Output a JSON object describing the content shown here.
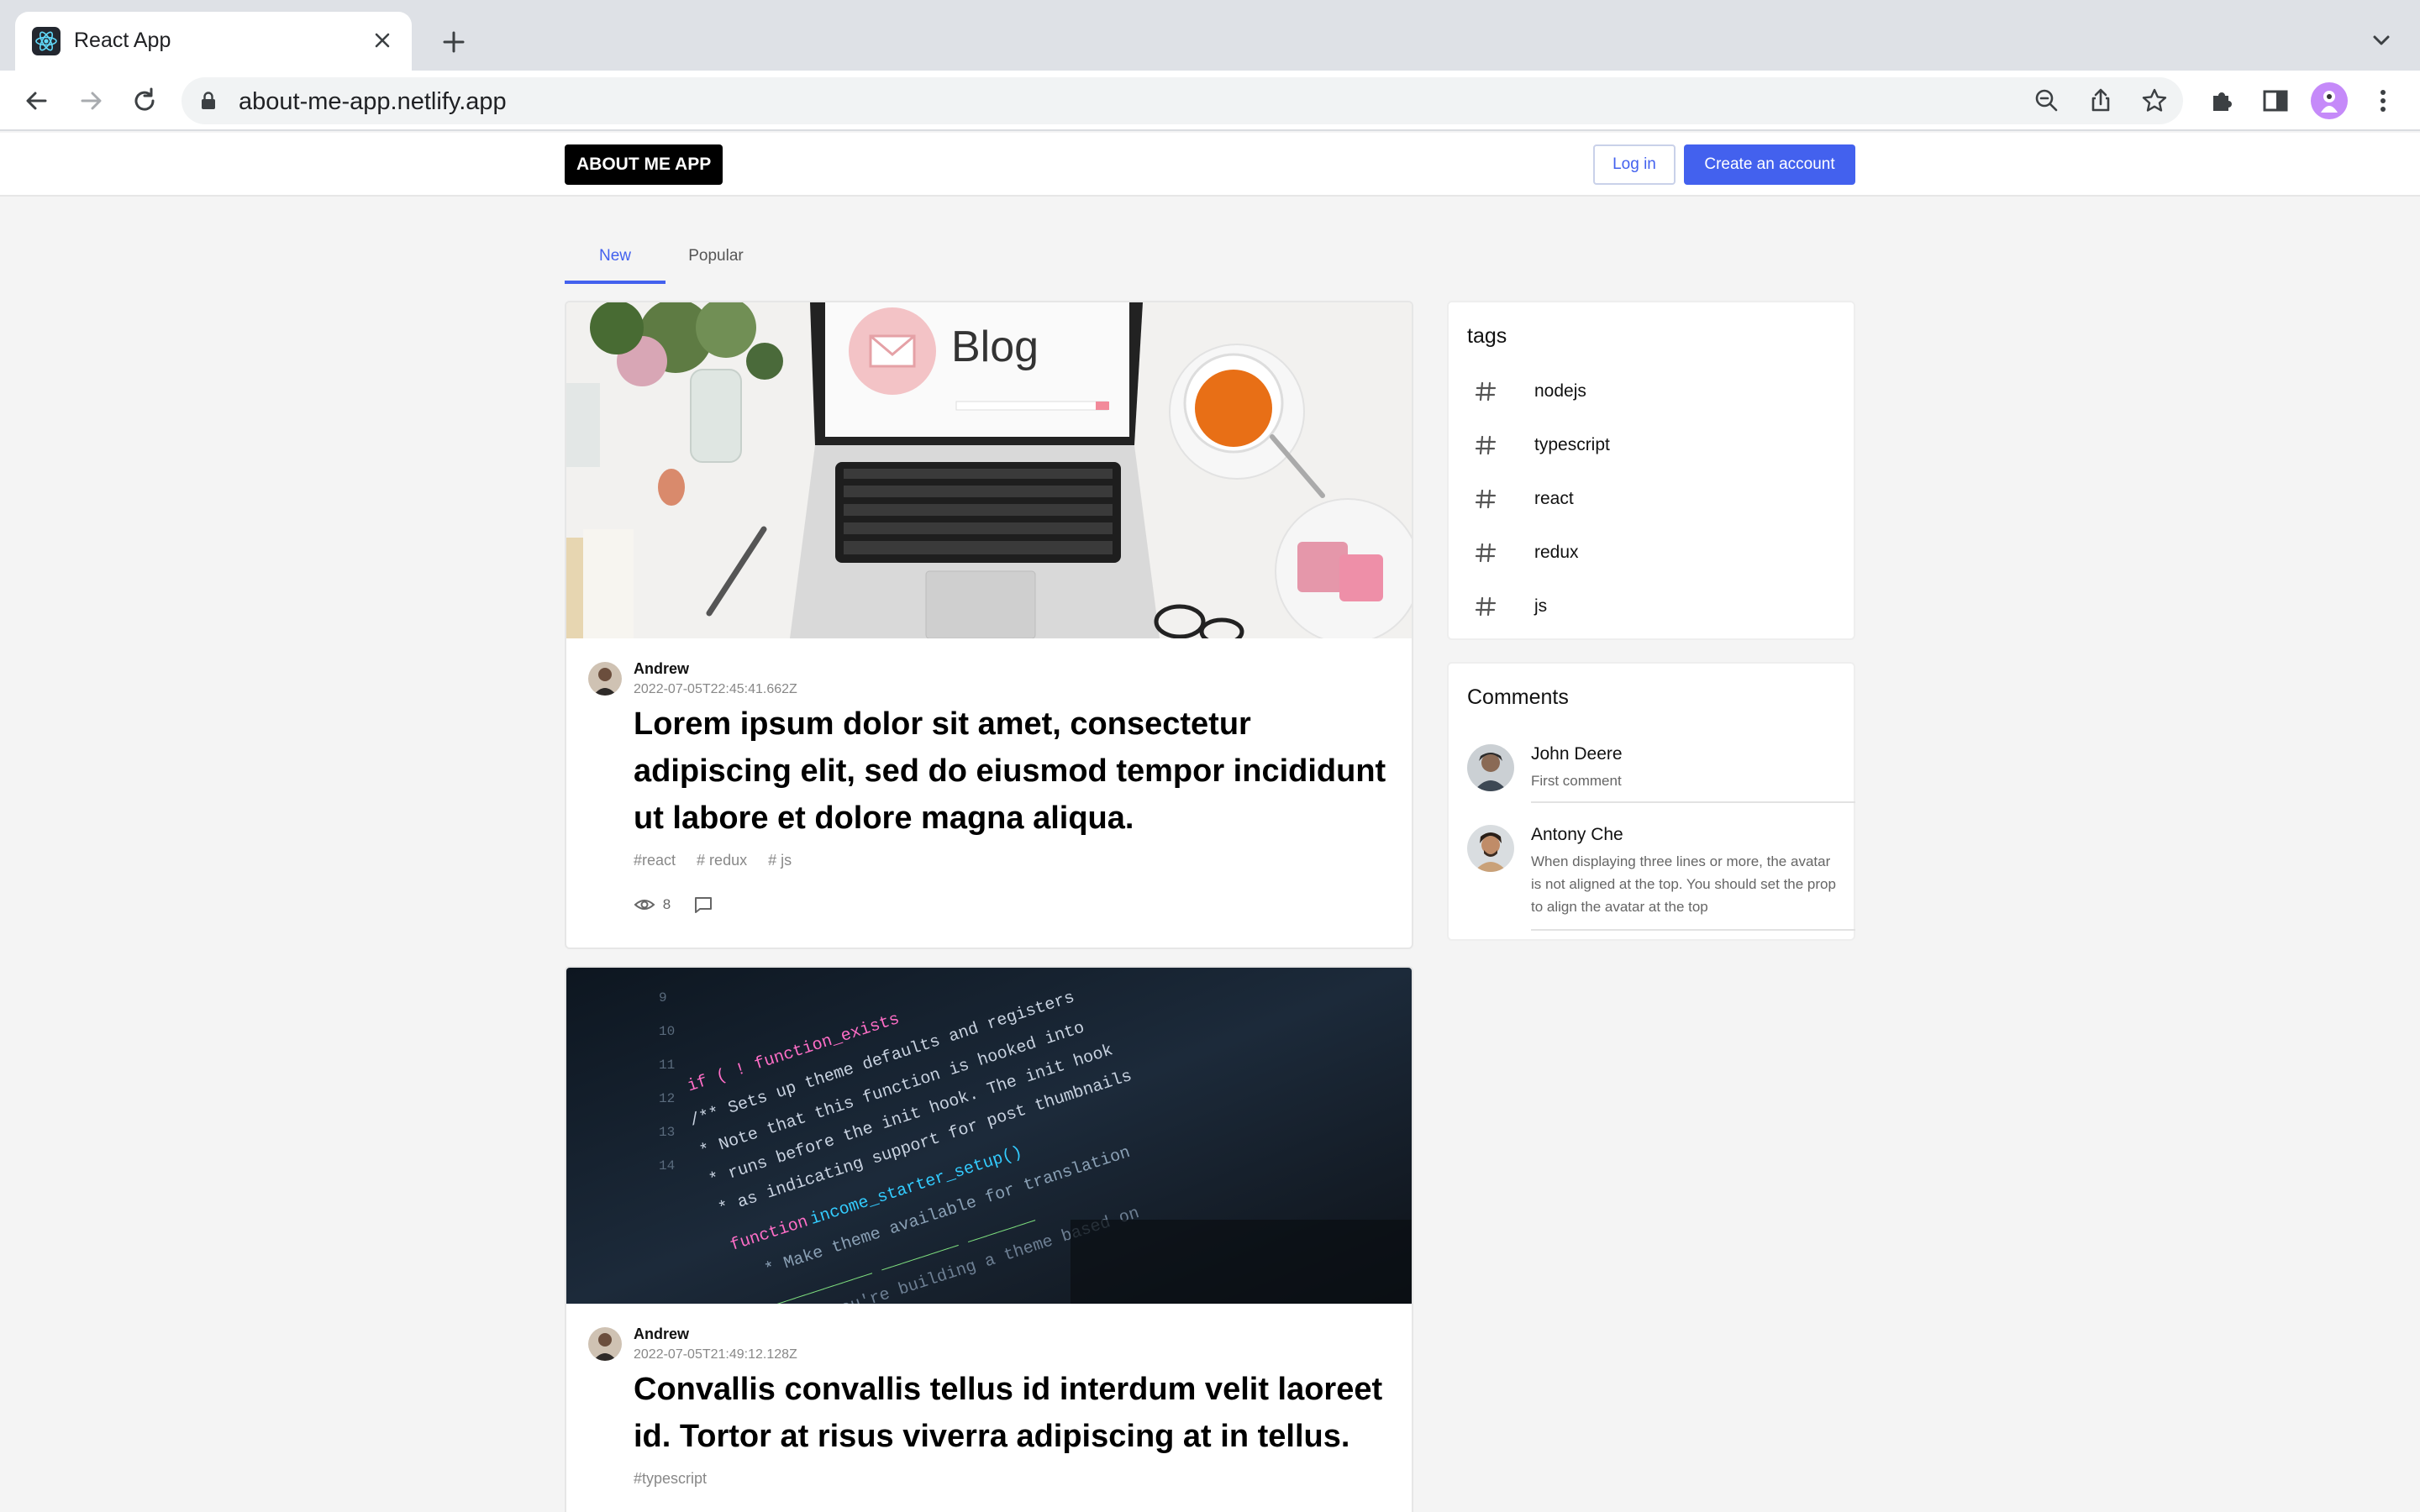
{
  "browser": {
    "tab_title": "React App",
    "url": "about-me-app.netlify.app"
  },
  "header": {
    "logo": "ABOUT ME APP",
    "login_label": "Log in",
    "create_label": "Create an account"
  },
  "tabs": [
    {
      "label": "New",
      "active": true
    },
    {
      "label": "Popular",
      "active": false
    }
  ],
  "posts": [
    {
      "image": "blog-laptop-photo",
      "author": "Andrew",
      "date": "2022-07-05T22:45:41.662Z",
      "title": "Lorem ipsum dolor sit amet, consectetur adipiscing elit, sed do eiusmod tempor incididunt ut labore et dolore magna aliqua.",
      "tags": [
        "#react",
        "# redux",
        "# js"
      ],
      "views": "8"
    },
    {
      "image": "code-laptop-photo",
      "author": "Andrew",
      "date": "2022-07-05T21:49:12.128Z",
      "title": "Convallis convallis tellus id interdum velit laoreet id. Tortor at risus viverra adipiscing at in tellus.",
      "tags": [
        "#typescript"
      ]
    }
  ],
  "sidebar": {
    "tags_title": "tags",
    "tags": [
      "nodejs",
      "typescript",
      "react",
      "redux",
      "js"
    ],
    "comments_title": "Comments",
    "comments": [
      {
        "name": "John Deere",
        "text": "First comment"
      },
      {
        "name": "Antony Che",
        "text": "When displaying three lines or more, the avatar is not aligned at the top. You should set the prop to align the avatar at the top"
      }
    ]
  },
  "colors": {
    "accent": "#4361ee",
    "page_bg": "#f4f4f4",
    "logo_bg": "#000000"
  }
}
